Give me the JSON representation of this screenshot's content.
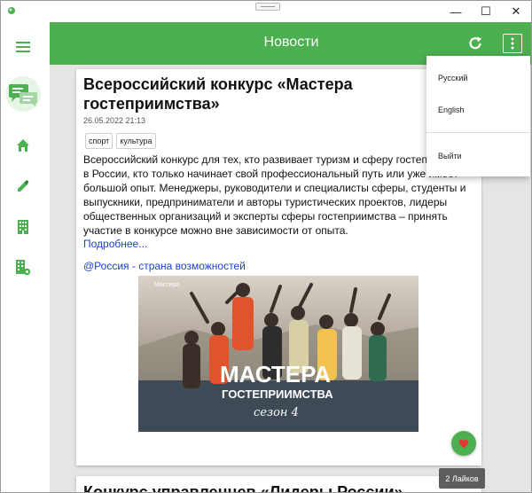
{
  "window": {
    "minimize_glyph": "—",
    "maximize_glyph": "☐",
    "close_glyph": "✕"
  },
  "sidebar": {
    "items": [
      {
        "icon": "hamburger-menu-icon"
      },
      {
        "icon": "chat-bubbles-icon"
      },
      {
        "icon": "home-icon"
      },
      {
        "icon": "pencil-icon"
      },
      {
        "icon": "building-icon"
      },
      {
        "icon": "building-settings-icon"
      }
    ]
  },
  "appbar": {
    "title": "Новости",
    "refresh_icon": "refresh-icon",
    "menu_icon": "more-vertical-icon"
  },
  "menu": {
    "items": [
      "Русский",
      "English",
      "Выйти"
    ]
  },
  "post": {
    "title": "Всероссийский конкурс «Мастера гостеприимства»",
    "date": "26.05.2022 21:13",
    "tags": [
      "спорт",
      "культура"
    ],
    "text_lines": [
      "Всероссийский конкурс для тех, кто развивает туризм и сферу гостеприимства",
      "в России, кто только начинает свой профессиональный путь или уже имеет",
      "большой опыт. Менеджеры, руководители и специалисты сферы, студенты и",
      "выпускники, предприниматели и авторы туристических проектов, лидеры",
      "общественных организаций и эксперты сферы гостеприимства – принять",
      "участие в конкурсе можно вне зависимости от опыта."
    ],
    "more_link": "Подробнее...",
    "source_link": "@Россия - страна возможностей",
    "image": {
      "brand": "Мастера",
      "headline_1": "МАСТЕРА",
      "headline_2": "ГОСТЕПРИИМСТВА",
      "script": "сезон 4"
    },
    "likes_label": "2 Лайков"
  },
  "next_post": {
    "title": "Конкурс управленцев «Лидеры России»"
  },
  "colors": {
    "accent": "#4caf50",
    "link": "#1a3fd6",
    "heart": "#e53935"
  }
}
